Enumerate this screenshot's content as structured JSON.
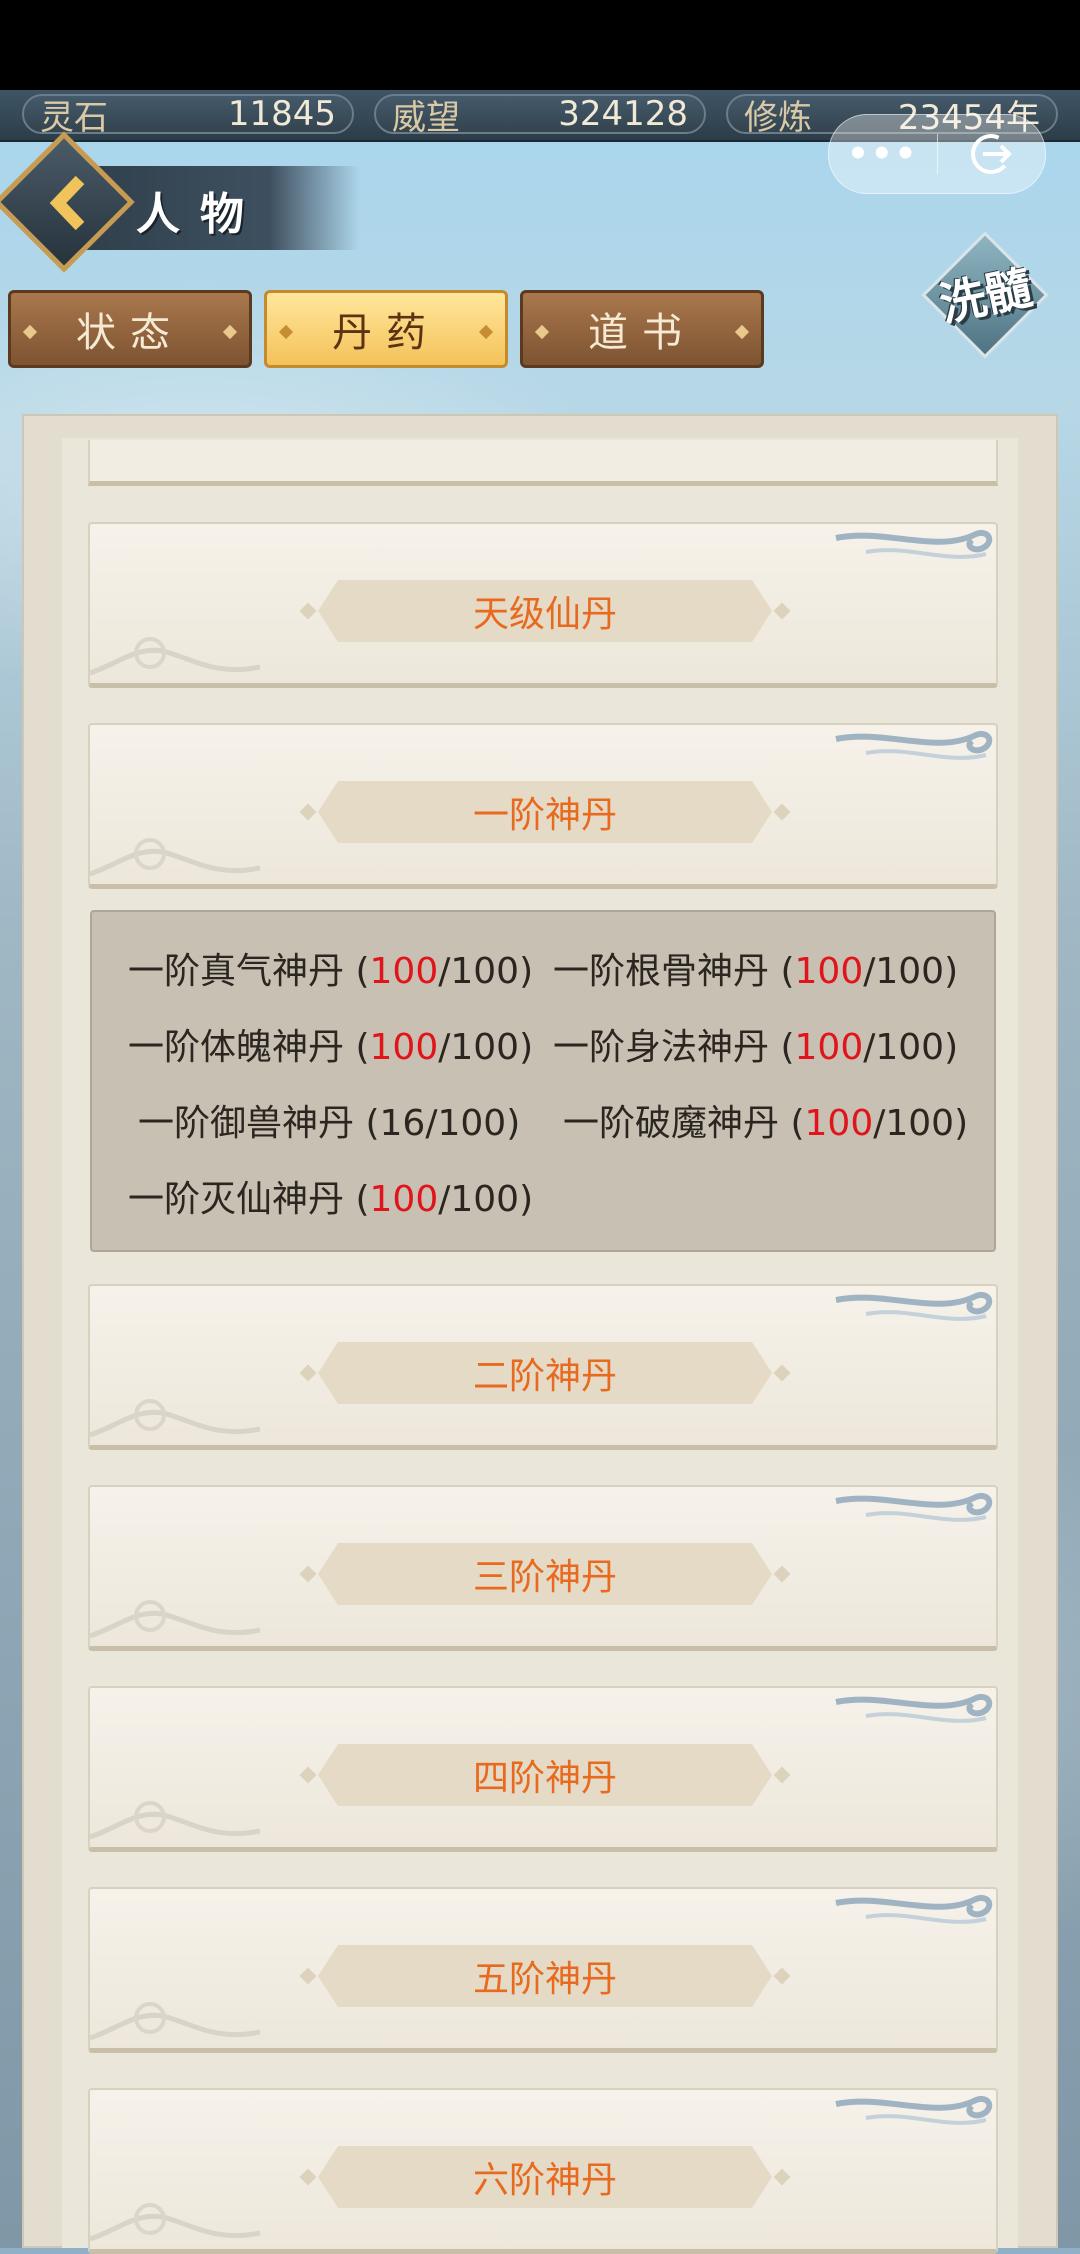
{
  "resources": [
    {
      "label": "灵石",
      "value": "11845"
    },
    {
      "label": "威望",
      "value": "324128"
    },
    {
      "label": "修炼",
      "value": "23454年"
    }
  ],
  "capsule": {
    "more_label": "•••"
  },
  "header": {
    "title": "人物"
  },
  "tabs": [
    {
      "label": "状态"
    },
    {
      "label": "丹药"
    },
    {
      "label": "道书"
    }
  ],
  "active_tab": "丹药",
  "xisui": {
    "label": "洗髓"
  },
  "categories": [
    {
      "label": "天级仙丹"
    },
    {
      "label": "一阶神丹"
    },
    {
      "label": "二阶神丹"
    },
    {
      "label": "三阶神丹"
    },
    {
      "label": "四阶神丹"
    },
    {
      "label": "五阶神丹"
    },
    {
      "label": "六阶神丹"
    }
  ],
  "pills": [
    {
      "name": "一阶真气神丹",
      "count": "100",
      "max": "100"
    },
    {
      "name": "一阶根骨神丹",
      "count": "100",
      "max": "100"
    },
    {
      "name": "一阶体魄神丹",
      "count": "100",
      "max": "100"
    },
    {
      "name": "一阶身法神丹",
      "count": "100",
      "max": "100"
    },
    {
      "name": "一阶御兽神丹",
      "count": "16",
      "max": "100"
    },
    {
      "name": "一阶破魔神丹",
      "count": "100",
      "max": "100"
    },
    {
      "name": "一阶灭仙神丹",
      "count": "100",
      "max": "100"
    }
  ],
  "colors": {
    "highlight": "#e86a1e",
    "full_count": "#e0141a",
    "active_tab": "#f4c25a"
  }
}
